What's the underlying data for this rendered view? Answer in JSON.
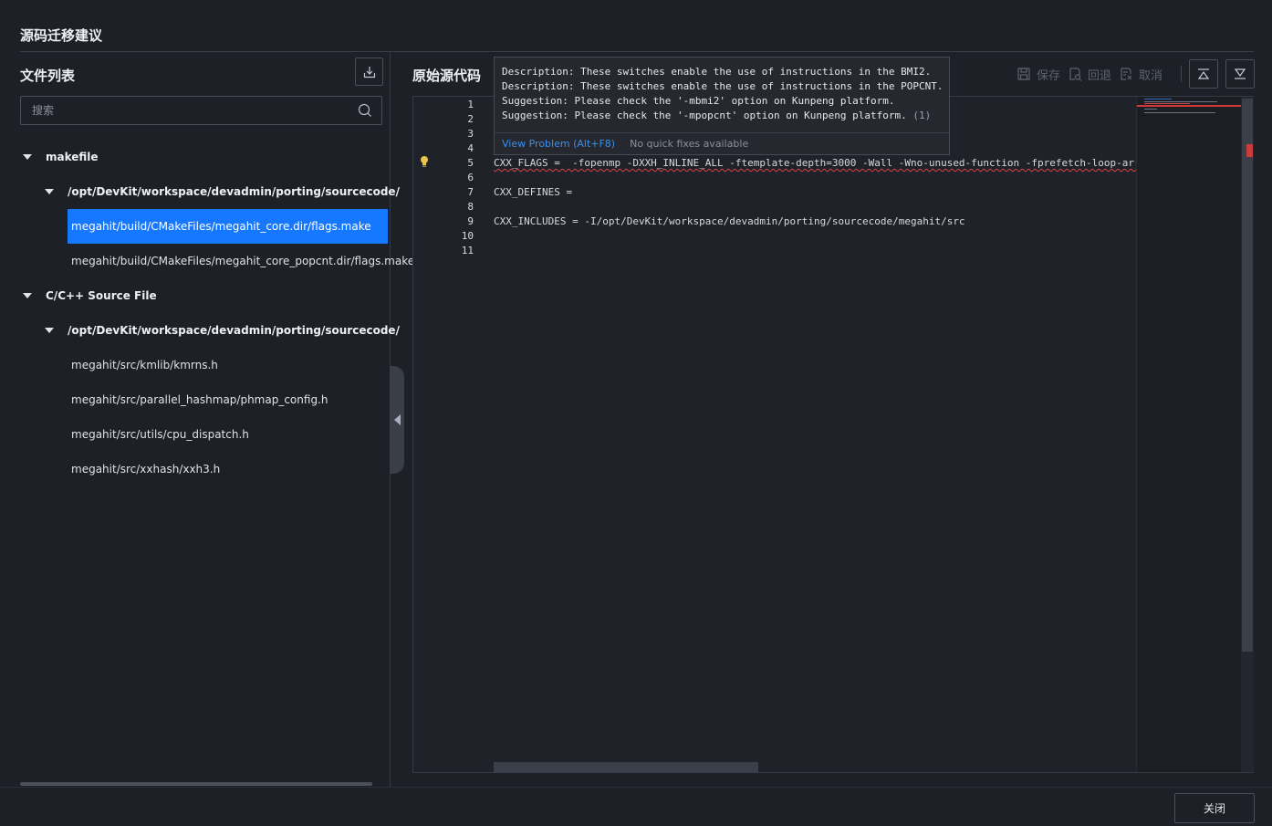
{
  "dialog": {
    "title": "源码迁移建议",
    "close_label": "关闭"
  },
  "file_list": {
    "heading": "文件列表",
    "search_placeholder": "搜索",
    "groups": [
      {
        "label": "makefile",
        "folder": "/opt/DevKit/workspace/devadmin/porting/sourcecode/",
        "files": [
          "megahit/build/CMakeFiles/megahit_core.dir/flags.make",
          "megahit/build/CMakeFiles/megahit_core_popcnt.dir/flags.make"
        ]
      },
      {
        "label": "C/C++ Source File",
        "folder": "/opt/DevKit/workspace/devadmin/porting/sourcecode/",
        "files": [
          "megahit/src/kmlib/kmrns.h",
          "megahit/src/parallel_hashmap/phmap_config.h",
          "megahit/src/utils/cpu_dispatch.h",
          "megahit/src/xxhash/xxh3.h"
        ]
      }
    ],
    "selected_file": "megahit/build/CMakeFiles/megahit_core.dir/flags.make"
  },
  "source": {
    "heading": "原始源代码",
    "toolbar": {
      "save_label": "保存",
      "revert_label": "回退",
      "cancel_label": "取消"
    },
    "line_numbers": [
      "1",
      "2",
      "3",
      "4",
      "5",
      "6",
      "7",
      "8",
      "9",
      "10",
      "11"
    ],
    "lines": {
      "l5": "CXX_FLAGS =  -fopenmp -DXXH_INLINE_ALL -ftemplate-depth=3000 -Wall -Wno-unused-function -fprefetch-loop-arr",
      "l7": "CXX_DEFINES =",
      "l9": "CXX_INCLUDES = -I/opt/DevKit/workspace/devadmin/porting/sourcecode/megahit/src"
    },
    "hover": {
      "messages": [
        "Description: These switches enable the use of instructions in the BMI2.",
        "Description: These switches enable the use of instructions in the POPCNT.",
        "Suggestion: Please check the '-mbmi2' option on Kunpeng platform.",
        "Suggestion: Please check the '-mpopcnt' option on Kunpeng platform."
      ],
      "count": "(1)",
      "view_problem": "View Problem (Alt+F8)",
      "no_fixes": "No quick fixes available"
    }
  },
  "colors": {
    "background": "#1d2027",
    "accent": "#1677ff",
    "error": "#e04343",
    "link": "#3b8eea"
  }
}
